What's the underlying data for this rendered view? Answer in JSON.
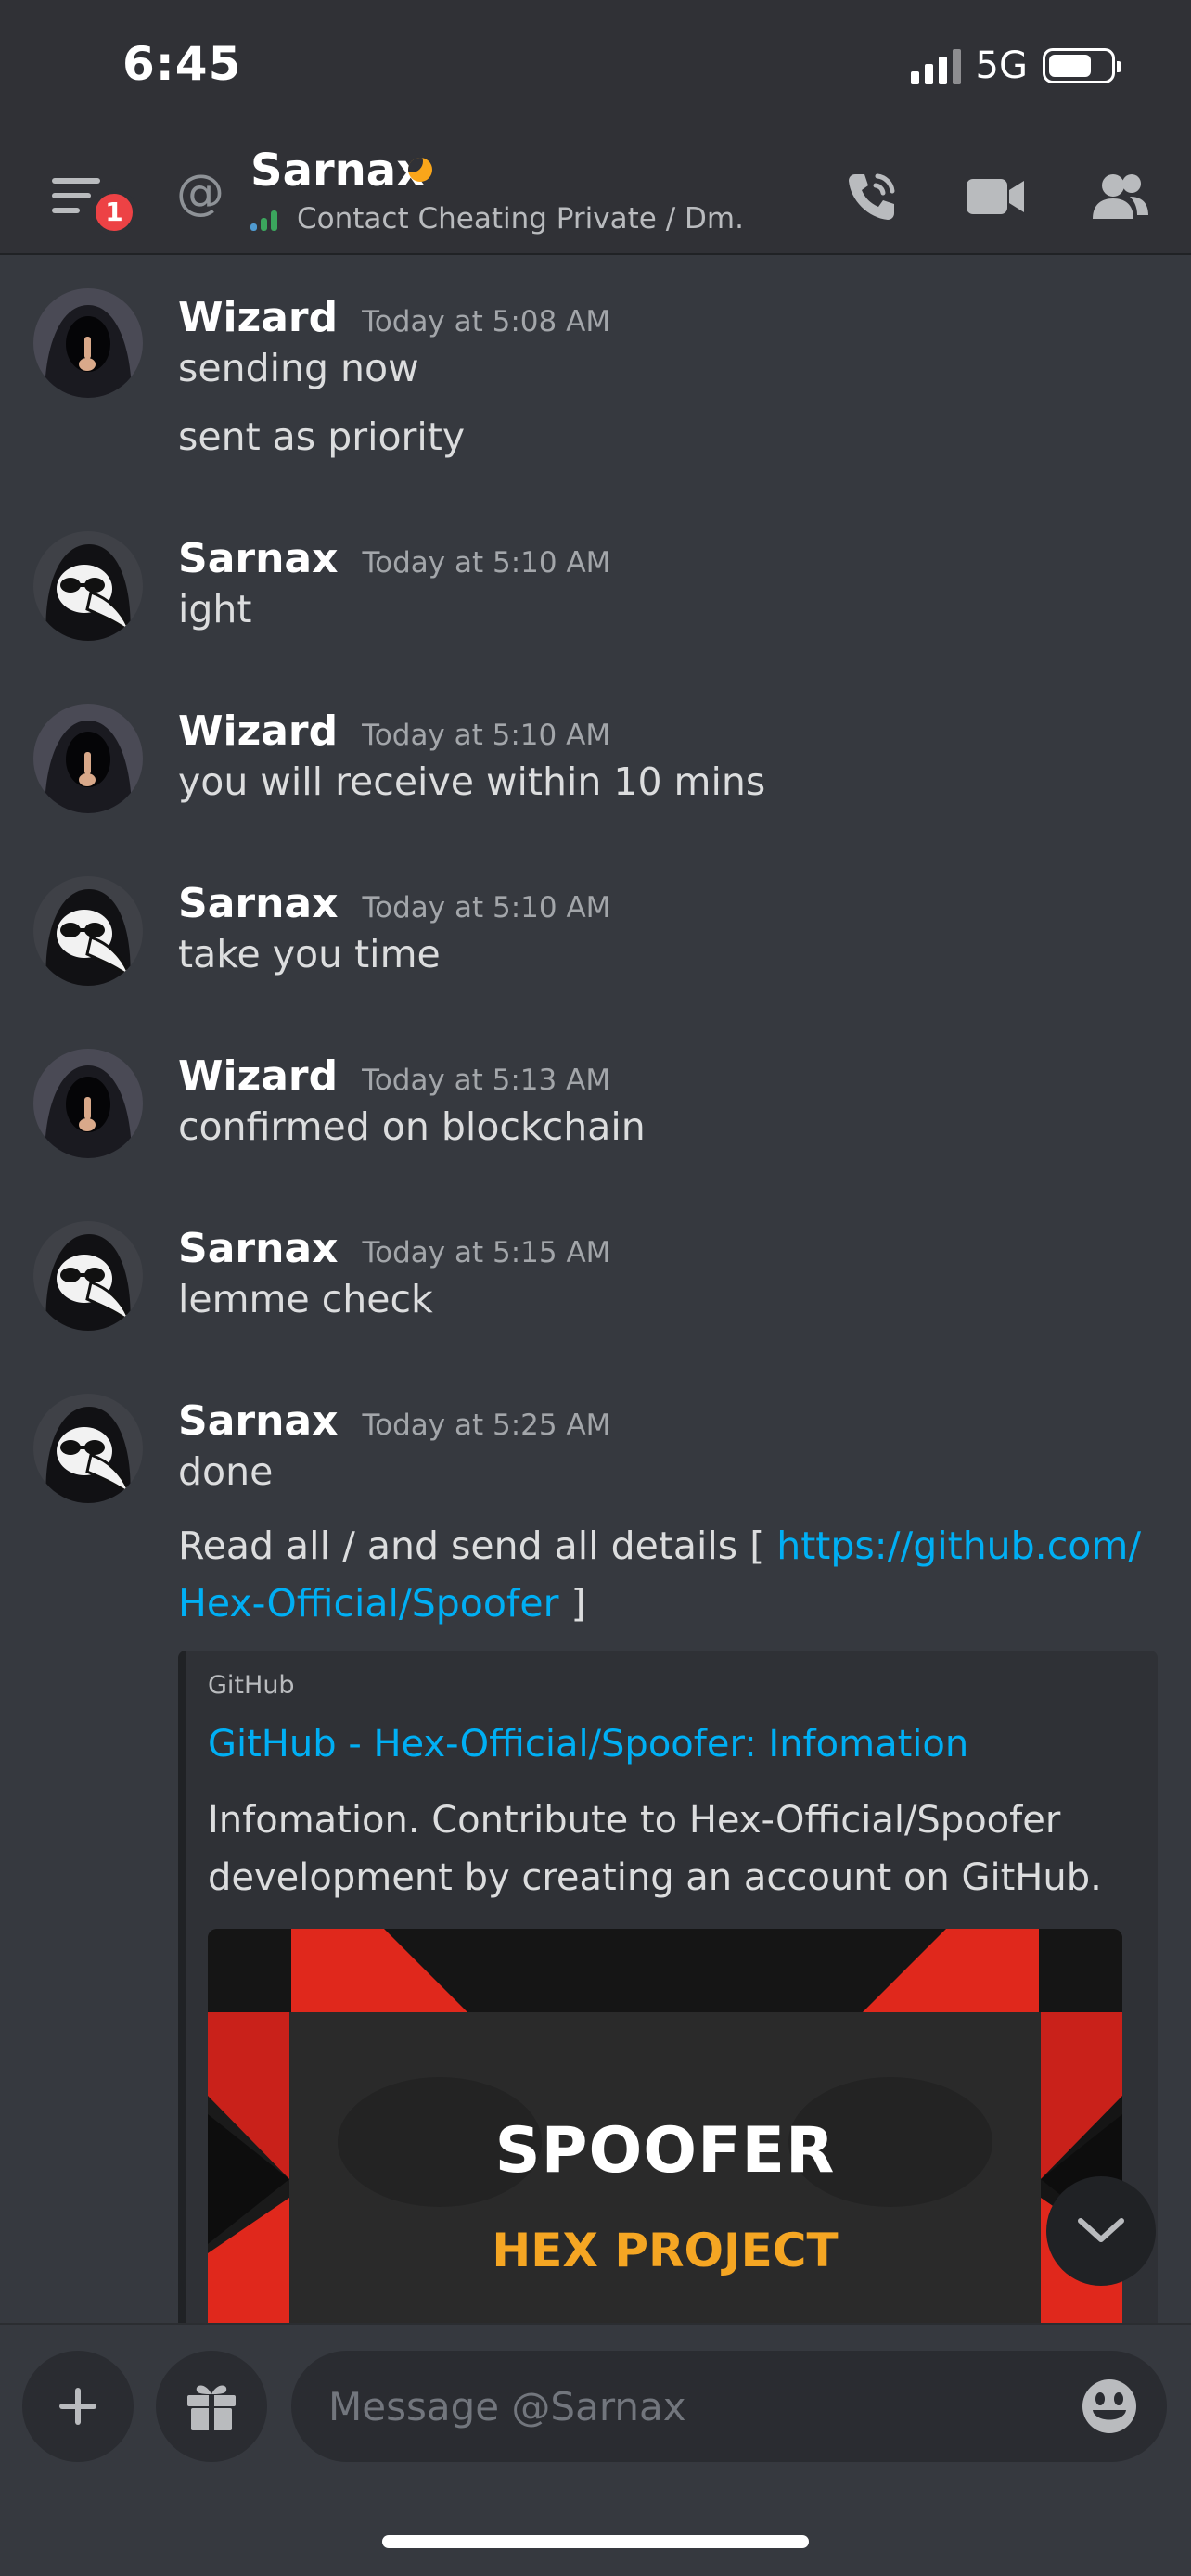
{
  "status_bar": {
    "time": "6:45",
    "network": "5G"
  },
  "header": {
    "notification_count": "1",
    "at_symbol": "@",
    "title": "Sarnax",
    "subtitle": "Contact Cheating Private / Dm."
  },
  "messages": [
    {
      "author": "Wizard",
      "timestamp": "Today at 5:08 AM",
      "avatar": "hooded-figure-avatar",
      "lines": [
        "sending now",
        "sent as priority"
      ]
    },
    {
      "author": "Sarnax",
      "timestamp": "Today at 5:10 AM",
      "avatar": "plague-doctor-avatar",
      "lines": [
        "ight"
      ]
    },
    {
      "author": "Wizard",
      "timestamp": "Today at 5:10 AM",
      "avatar": "hooded-figure-avatar",
      "lines": [
        "you will receive within 10 mins"
      ]
    },
    {
      "author": "Sarnax",
      "timestamp": "Today at 5:10 AM",
      "avatar": "plague-doctor-avatar",
      "lines": [
        "take you time"
      ]
    },
    {
      "author": "Wizard",
      "timestamp": "Today at 5:13 AM",
      "avatar": "hooded-figure-avatar",
      "lines": [
        "confirmed on blockchain"
      ]
    },
    {
      "author": "Sarnax",
      "timestamp": "Today at 5:15 AM",
      "avatar": "plague-doctor-avatar",
      "lines": [
        "lemme check"
      ]
    },
    {
      "author": "Sarnax",
      "timestamp": "Today at 5:25 AM",
      "avatar": "plague-doctor-avatar",
      "lines": [
        "done"
      ],
      "link_message": {
        "prefix": "Read all / and send all details [ ",
        "link_part1": "https://github.com/",
        "link_part2": "Hex-Official/Spoofer",
        "suffix": " ]"
      },
      "embed": {
        "provider": "GitHub",
        "title": "GitHub - Hex-Official/Spoofer: Infomation",
        "description": "Infomation. Contribute to Hex-Official/Spoofer development by creating an account on GitHub.",
        "image_title": "SPOOFER",
        "image_subtitle": "HEX PROJECT"
      }
    }
  ],
  "composer": {
    "placeholder": "Message @Sarnax"
  },
  "colors": {
    "background": "#36393f",
    "header": "#303136",
    "link": "#00aff4",
    "badge": "#ed4245",
    "idle": "#faa61a",
    "accent_red": "#e0281c",
    "hex_orange": "#f5a623"
  },
  "icons": [
    "menu-icon",
    "call-icon",
    "video-icon",
    "members-icon",
    "plus-icon",
    "gift-icon",
    "emoji-icon",
    "chevron-down-icon"
  ]
}
